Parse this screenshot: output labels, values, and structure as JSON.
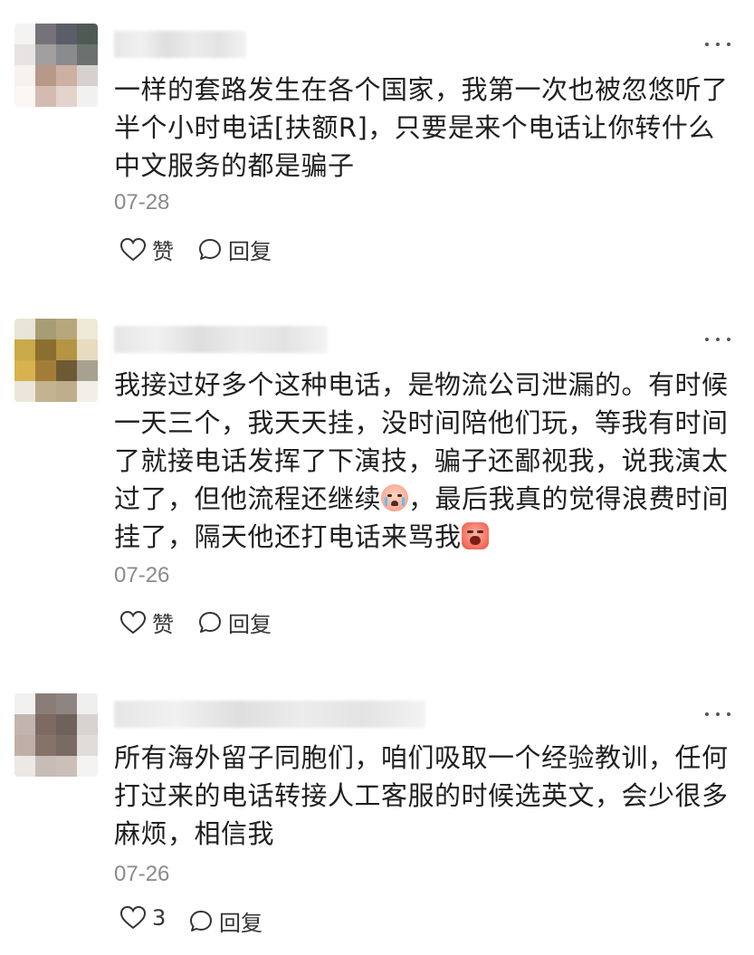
{
  "comments": [
    {
      "text": "一样的套路发生在各个国家，我第一次也被忽悠听了半个小时电话[扶额R]，只要是来个电话让你转什么中文服务的都是骗子",
      "date": "07-28",
      "like_label": "赞",
      "reply_label": "回复",
      "more_icon": "more-icon",
      "avatar_colors": [
        "#f4f3f2",
        "#76727a",
        "#595e67",
        "#4f5a55",
        "#e6e3e2",
        "#a19e9f",
        "#8a8b8d",
        "#6b716f",
        "#f7f2ef",
        "#b79889",
        "#ccb0a2",
        "#d6d1cf",
        "#fbf7f5",
        "#d3bbb1",
        "#e2d3cc",
        "#f3f1f0"
      ]
    },
    {
      "text_parts": [
        "我接过好多个这种电话，是物流公司泄漏的。有时候一天三个，我天天挂，没时间陪他们玩，等我有时间了就接电话发挥了下演技，骗子还鄙视我，说我演太过了，但他流程还继续",
        "，最后我真的觉得浪费时间挂了，隔天他还打电话来骂我"
      ],
      "emoji_1": "crying-emoji",
      "emoji_2": "angry-emoji",
      "date": "07-26",
      "like_label": "赞",
      "reply_label": "回复",
      "avatar_colors": [
        "#e8e4d6",
        "#a79c76",
        "#b6a87a",
        "#efe9d8",
        "#c9a948",
        "#8b6f2f",
        "#b59543",
        "#e7dcc0",
        "#d8b24f",
        "#a37d37",
        "#6d5a34",
        "#a9a190",
        "#ebe6dc",
        "#c3b390",
        "#bfae8c",
        "#f2efe9"
      ]
    },
    {
      "text": "所有海外留子同胞们，咱们吸取一个经验教训，任何打过来的电话转接人工客服的时候选英文，会少很多麻烦，相信我",
      "date": "07-26",
      "like_count": "3",
      "reply_label": "回复",
      "avatar_colors": [
        "#f3f1f0",
        "#8a7d77",
        "#8e8582",
        "#f1efee",
        "#c2b5b0",
        "#7d6a62",
        "#6f625d",
        "#d8d2d0",
        "#c0afa8",
        "#857269",
        "#796a64",
        "#e2dcd9",
        "#ece8e6",
        "#c8bcb7",
        "#cbbfba",
        "#f5f3f2"
      ]
    }
  ]
}
